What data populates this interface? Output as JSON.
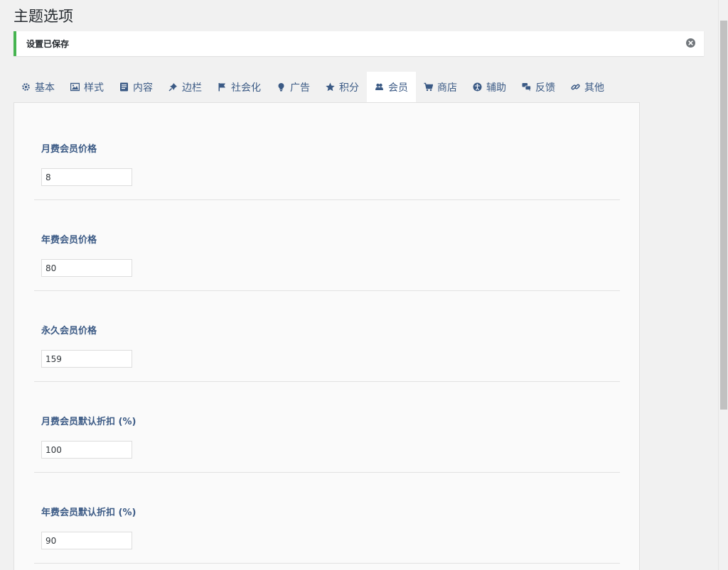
{
  "page": {
    "title": "主题选项"
  },
  "notice": {
    "text": "设置已保存",
    "accent": "#46b450"
  },
  "tabs": [
    {
      "label": "基本",
      "icon": "gear-icon"
    },
    {
      "label": "样式",
      "icon": "image-icon"
    },
    {
      "label": "内容",
      "icon": "document-icon"
    },
    {
      "label": "边栏",
      "icon": "pin-icon"
    },
    {
      "label": "社会化",
      "icon": "flag-icon"
    },
    {
      "label": "广告",
      "icon": "lightbulb-icon"
    },
    {
      "label": "积分",
      "icon": "star-icon"
    },
    {
      "label": "会员",
      "icon": "users-icon",
      "active": true
    },
    {
      "label": "商店",
      "icon": "cart-icon"
    },
    {
      "label": "辅助",
      "icon": "accessibility-icon"
    },
    {
      "label": "反馈",
      "icon": "comments-icon"
    },
    {
      "label": "其他",
      "icon": "link-icon"
    }
  ],
  "fields": [
    {
      "label": "月费会员价格",
      "value": "8"
    },
    {
      "label": "年费会员价格",
      "value": "80"
    },
    {
      "label": "永久会员价格",
      "value": "159"
    },
    {
      "label": "月费会员默认折扣 (%)",
      "value": "100"
    },
    {
      "label": "年费会员默认折扣 (%)",
      "value": "90"
    }
  ],
  "colors": {
    "tab_text": "#3b5a85",
    "label_text": "#3b5a85",
    "success": "#46b450"
  }
}
